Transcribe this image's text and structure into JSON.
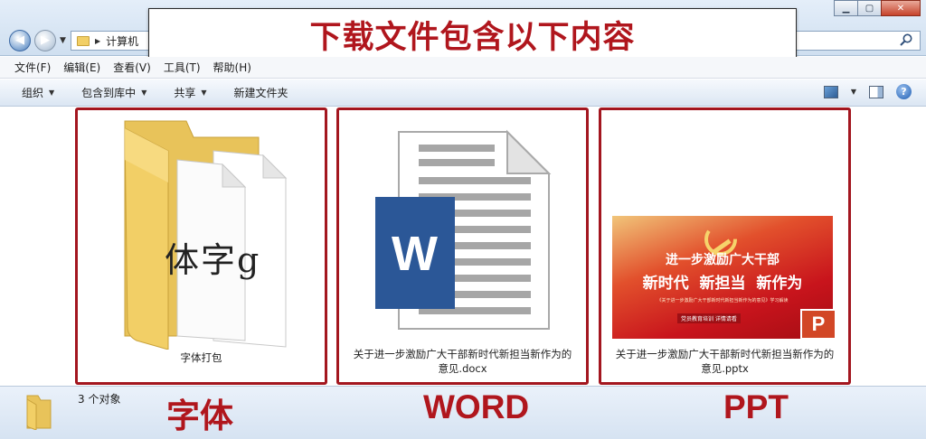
{
  "window": {
    "address_path": "计算机",
    "controls": {
      "minimize": "▁",
      "maximize": "▢",
      "close": "✕"
    }
  },
  "banner": {
    "text": "下载文件包含以下内容"
  },
  "menubar": {
    "items": [
      {
        "label": "文件(F)"
      },
      {
        "label": "编辑(E)"
      },
      {
        "label": "查看(V)"
      },
      {
        "label": "工具(T)"
      },
      {
        "label": "帮助(H)"
      }
    ]
  },
  "cmdbar": {
    "organize": "组织",
    "include_library": "包含到库中",
    "share": "共享",
    "new_folder": "新建文件夹",
    "help": "?"
  },
  "files": [
    {
      "name": "字体打包",
      "type_label": "字体",
      "glyphs": "体字g"
    },
    {
      "name_line1": "关于进一步激励广大干部新时代新担当新作为的",
      "name_line2": "意见.docx",
      "type_label": "WORD",
      "icon_letter": "W"
    },
    {
      "name_line1": "关于进一步激励广大干部新时代新担当新作为的",
      "name_line2": "意见.pptx",
      "type_label": "PPT",
      "thumb_title": "进一步激励广大干部",
      "thumb_slogan": "新时代  新担当  新作为",
      "thumb_small": "《关于进一步激励广大干部新时代新担当新作为的意见》学习解读",
      "thumb_button": "党员教育培训  详情请看",
      "icon_letter": "P"
    }
  ],
  "status": {
    "count": "3 个对象"
  },
  "colors": {
    "accent_red": "#b0161d",
    "word_blue": "#2b5797",
    "ppt_orange": "#d24726",
    "folder_yellow": "#f2cf66"
  }
}
